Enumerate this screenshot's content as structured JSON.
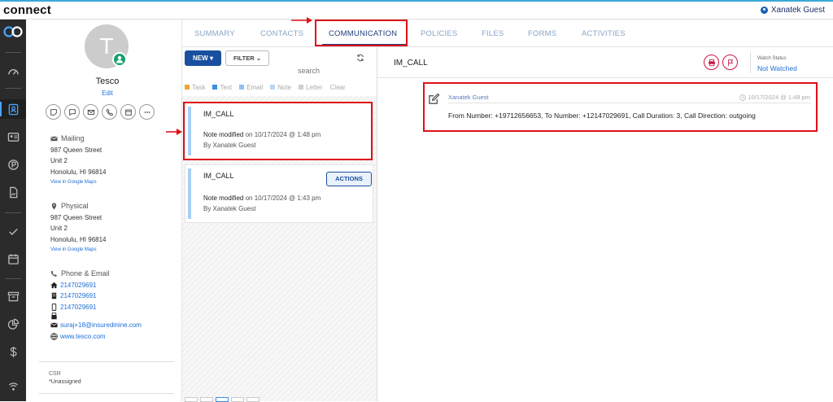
{
  "app": {
    "brand": "connect",
    "user_name": "Xanatek Guest"
  },
  "tabs": [
    {
      "label": "SUMMARY"
    },
    {
      "label": "CONTACTS"
    },
    {
      "label": "COMMUNICATION"
    },
    {
      "label": "POLICIES"
    },
    {
      "label": "FILES"
    },
    {
      "label": "FORMS"
    },
    {
      "label": "ACTIVITIES"
    }
  ],
  "active_tab": "COMMUNICATION",
  "contact": {
    "initial": "T",
    "name": "Tesco",
    "edit_label": "Edit",
    "mailing": {
      "label": "Mailing",
      "line1": "987 Queen Street",
      "line2": "Unit 2",
      "line3": "Honolulu, HI 96814",
      "map_link": "View in Google Maps"
    },
    "physical": {
      "label": "Physical",
      "line1": "987 Queen Street",
      "line2": "Unit 2",
      "line3": "Honolulu, HI 96814",
      "map_link": "View in Google Maps"
    },
    "phone_email": {
      "label": "Phone & Email",
      "home_phone": "2147029691",
      "work_phone": "2147029691",
      "mobile_phone": "2147029691",
      "email": "suraj+18@insuredmine.com",
      "website": "www.tesco.com"
    },
    "csr": {
      "label": "CSR",
      "value": "*Unassigned"
    }
  },
  "list": {
    "new_label": "NEW",
    "filter_label": "FILTER",
    "search_placeholder": "search",
    "legend": [
      {
        "label": "Task",
        "color": "#f0a534"
      },
      {
        "label": "Text",
        "color": "#3a8fe0"
      },
      {
        "label": "Email",
        "color": "#8ec3f0"
      },
      {
        "label": "Note",
        "color": "#b9d4f0"
      },
      {
        "label": "Letter",
        "color": "#cfcfcf"
      }
    ],
    "clear_label": "Clear",
    "items": [
      {
        "title": "IM_CALL",
        "action": "Note modified",
        "when": "on 10/17/2024 @ 1:48 pm",
        "by": "By Xanatek Guest"
      },
      {
        "title": "IM_CALL",
        "action": "Note modified",
        "when": "on 10/17/2024 @ 1:43 pm",
        "by": "By Xanatek Guest",
        "button": "ACTIONS"
      }
    ]
  },
  "detail": {
    "title": "IM_CALL",
    "watch_label": "Watch Status",
    "watch_value": "Not Watched",
    "note": {
      "author": "Xanatek Guest",
      "timestamp": "10/17/2024 @ 1:48 pm",
      "body": "From Number: +19712656653, To Number: +12147029691, Call Duration: 3, Call Direction: outgoing"
    }
  },
  "colors": {
    "accent": "#1a4fa0",
    "highlight": "#e0101a",
    "rail": "#2b2b2b"
  }
}
